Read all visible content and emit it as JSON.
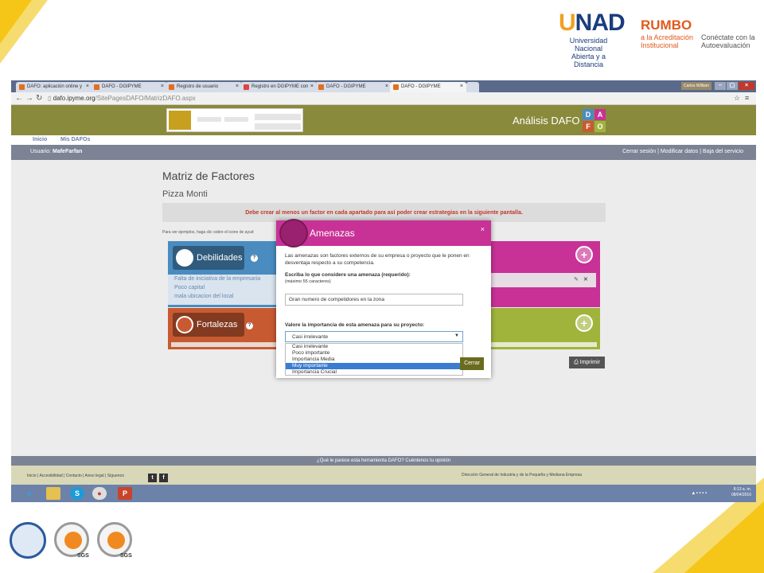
{
  "slide_logos": {
    "unad_brand_u": "U",
    "unad_brand_nad": "NAD",
    "unad_line1": "Universidad Nacional",
    "unad_line2": "Abierta y a Distancia",
    "rumbo_title": "RUMBO",
    "rumbo_line1": "a la Acreditación",
    "rumbo_line2": "Institucional",
    "rumbo_side1": "Conéctate con la",
    "rumbo_side2": "Autoevaluación",
    "sgs1": "SGS",
    "sgs2": "SGS"
  },
  "browser": {
    "tabs": [
      {
        "label": "DAFO: aplicación online y"
      },
      {
        "label": "DAFO - DGIPYME"
      },
      {
        "label": "Registro de usuario"
      },
      {
        "label": "Registro en DGIPYME con"
      },
      {
        "label": "DAFO - DGIPYME"
      },
      {
        "label": "DAFO - DGIPYME"
      }
    ],
    "user_label": "Carlos William",
    "url_host": "dafo.ipyme.org",
    "url_path": "/SitePagesDAFO/MatrizDAFO.aspx"
  },
  "site": {
    "title": "Análisis DAFO",
    "dafo_letters": [
      "D",
      "A",
      "F",
      "O"
    ],
    "menu": [
      "Inicio",
      "Mis DAFOs"
    ],
    "user_prefix": "Usuario:",
    "user_name": "MafeFarfan",
    "user_links": "Cerrar sesión | Modificar datos | Baja del servicio"
  },
  "page": {
    "heading": "Matriz de Factores",
    "company": "Pizza Monti",
    "warning": "Debe crear al menos un factor en cada apartado para así poder crear estrategias en la siguiente pantalla.",
    "hint": "Para ver ejemplos, haga clic sobre el icono de ayud",
    "debilidades": {
      "label": "Debilidades",
      "items": [
        "Falta de iniciativa de la empresaria",
        "Poco capital",
        "mala ubicacion del local"
      ]
    },
    "fortalezas": {
      "label": "Fortalezas"
    },
    "help": "?",
    "plus": "+",
    "print_label": "Imprimir"
  },
  "modal": {
    "title": "Amenazas",
    "close": "×",
    "intro": "Las amenazas son factores externos de su empresa o proyecto que le ponen en desventaja respecto a su competencia.",
    "field_label": "Escriba lo que considere una amenaza (requerido):",
    "field_note": "(máximo 55 caracteres)",
    "field_value": "Gran numero de competidores en la zona",
    "select_label": "Valore la importancia de esta amenaza para su proyecto:",
    "select_value": "Casi irrelevante",
    "options": [
      "Casi irrelevante",
      "Poco importante",
      "Importancia Media",
      "Muy importante",
      "Importancia Crucial"
    ],
    "selected_option_index": 3,
    "cerrar": "Cerrar"
  },
  "footer": {
    "opinion": "¿Qué le parece esta herramienta DAFO? Cuéntenos tu opinión",
    "links": "Inicio | Accesibilidad | Contacto | Aviso legal | Síguenos",
    "ministry": "Dirección General de Industria y de la Pequeña y Mediana Empresa"
  },
  "taskbar": {
    "time": "8:13 a. m.",
    "date": "08/04/2016"
  },
  "colors": {
    "debilidades": "#4a8cc0",
    "fortalezas": "#c85a32",
    "amenazas": "#c83296",
    "oportunidades": "#a0b43c",
    "header": "#8a8a3c"
  }
}
